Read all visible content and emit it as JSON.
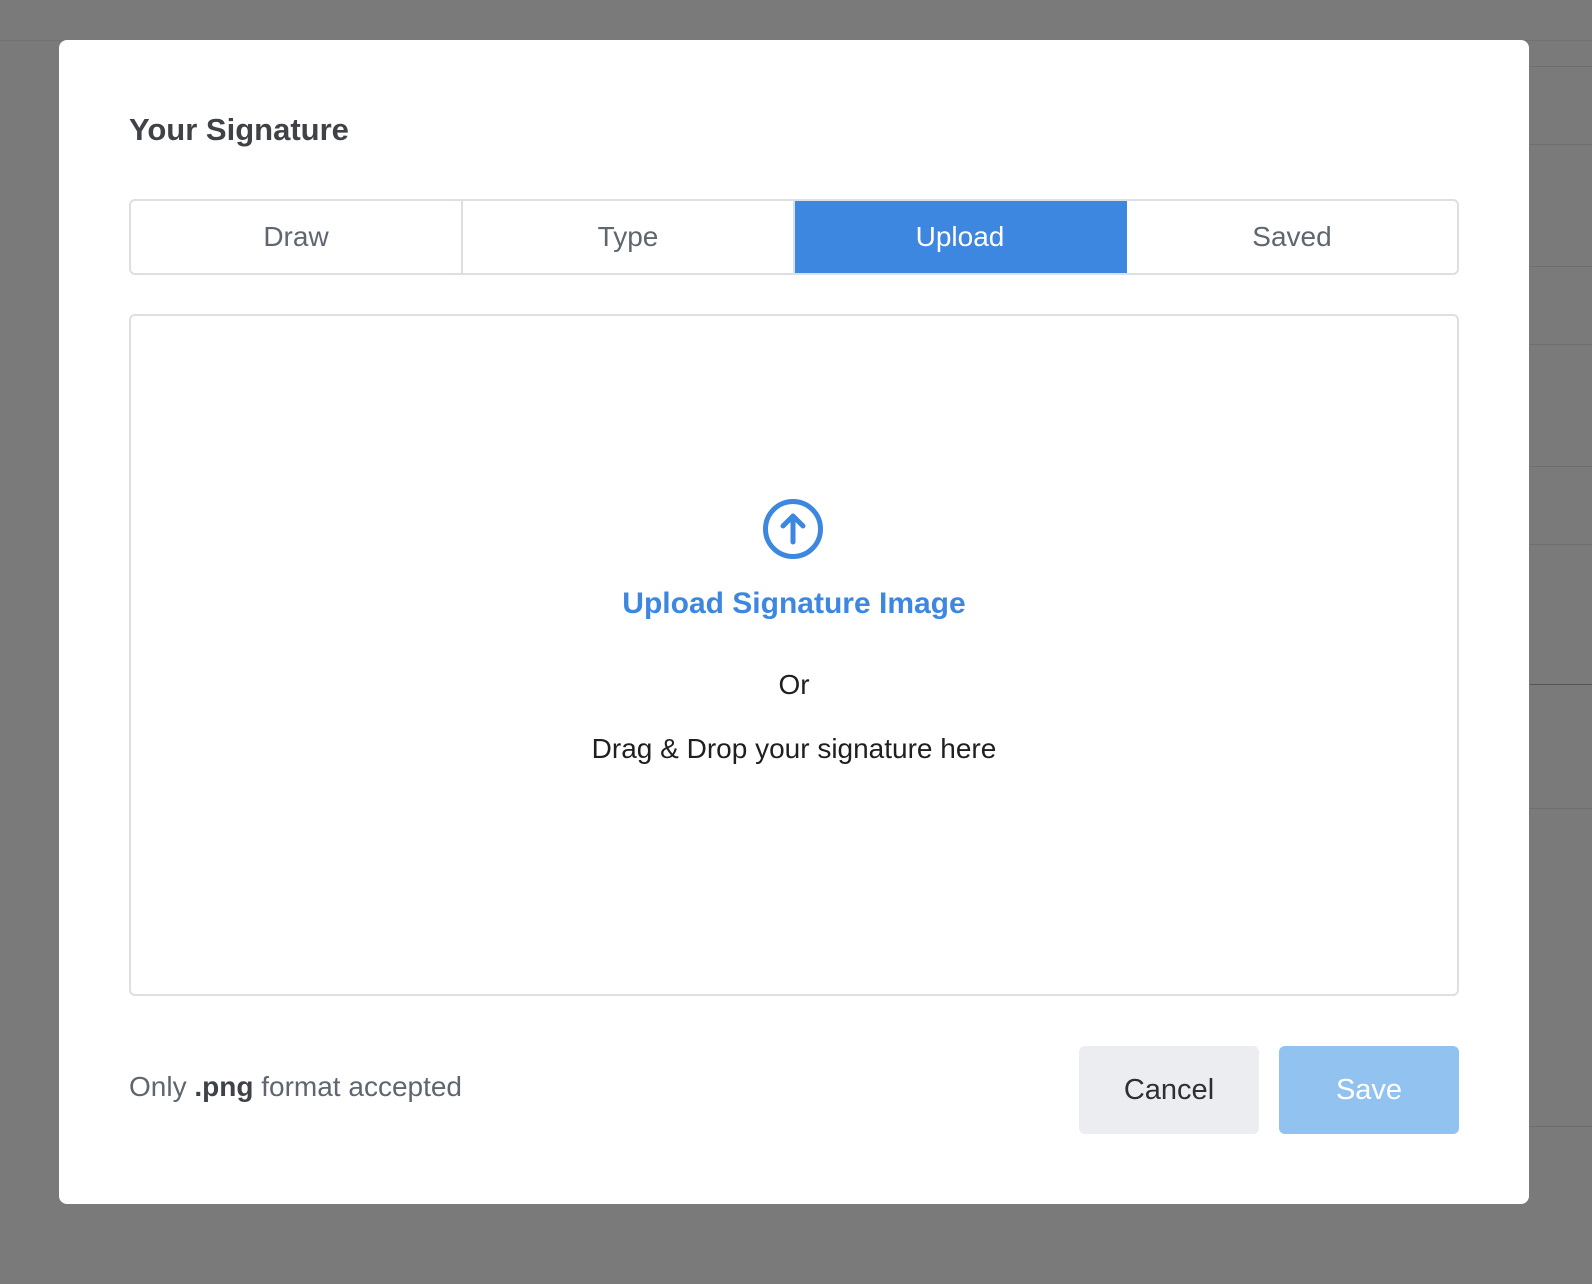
{
  "dialog": {
    "title": "Your Signature"
  },
  "tabs": [
    {
      "label": "Draw",
      "active": false
    },
    {
      "label": "Type",
      "active": false
    },
    {
      "label": "Upload",
      "active": true
    },
    {
      "label": "Saved",
      "active": false
    }
  ],
  "upload": {
    "icon": "upload-arrow-circle-icon",
    "link_label": "Upload Signature Image",
    "or_text": "Or",
    "drag_text": "Drag & Drop your signature here"
  },
  "footer": {
    "note_prefix": "Only",
    "note_format": ".png",
    "note_suffix": "format accepted",
    "cancel_label": "Cancel",
    "save_label": "Save",
    "save_disabled": true
  },
  "colors": {
    "accent": "#3d87e0",
    "save_disabled": "#92c3f0",
    "overlay": "#7a7a7a"
  }
}
